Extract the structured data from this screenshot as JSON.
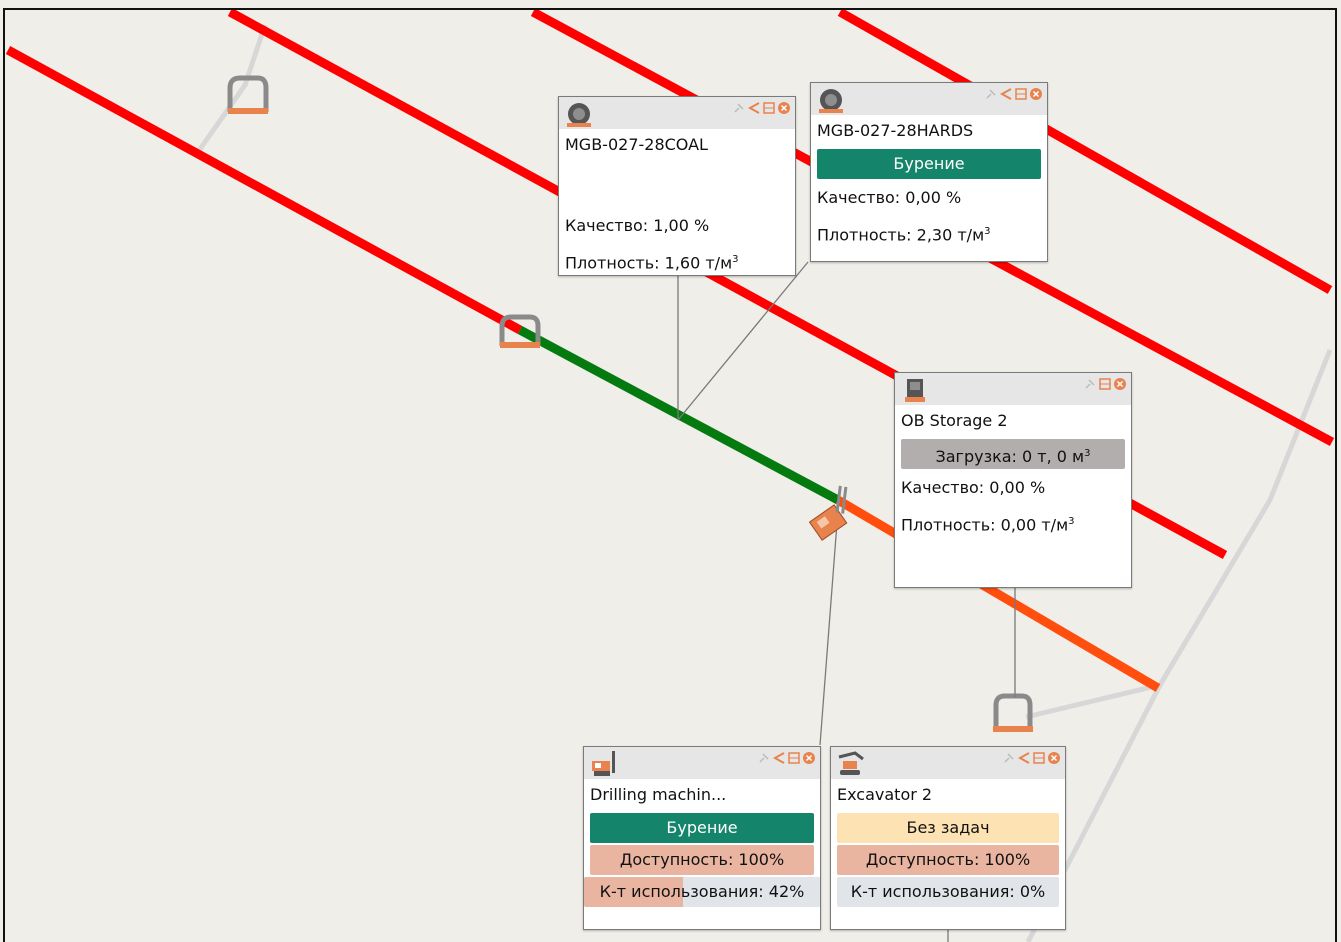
{
  "colors": {
    "map_bg": "#f0eee9",
    "road_red": "#ff0000",
    "road_green": "#047a0f",
    "road_orange": "#ff4e0e",
    "road_grey": "#d7d7d7",
    "status_drilling": "#14856b",
    "status_idle": "#fde3b3",
    "load_grey": "#b2aeae",
    "availability": "#e9b4a0",
    "utilization_track": "#e1e5ea",
    "utilization_fill": "#e9b4a0",
    "icon_orange": "#e8834e"
  },
  "cards": {
    "coal": {
      "icon": "sphere-icon",
      "title": "MGB-027-28COAL",
      "quality": "Качество: 1,00 %",
      "density_prefix": "Плотность: 1,60 т/м",
      "density_sup": "3"
    },
    "hards": {
      "icon": "sphere-icon",
      "title": "MGB-027-28HARDS",
      "status": "Бурение",
      "quality": "Качество: 0,00 %",
      "density_prefix": "Плотность: 2,30 т/м",
      "density_sup": "3"
    },
    "storage": {
      "icon": "storage-bin-icon",
      "title": "OB Storage 2",
      "load": "Загрузка: 0 т, 0 м",
      "load_sup": "3",
      "quality": "Качество: 0,00 %",
      "density_prefix": "Плотность: 0,00 т/м",
      "density_sup": "3"
    },
    "drill": {
      "icon": "drilling-rig-icon",
      "title": "Drilling machin...",
      "status": "Бурение",
      "availability": "Доступность: 100%",
      "availability_value": 1.0,
      "utilization": "К-т использования: 42%",
      "utilization_value": 0.42
    },
    "excavator": {
      "icon": "excavator-icon",
      "title": "Excavator 2",
      "status": "Без задач",
      "availability": "Доступность: 100%",
      "availability_value": 1.0,
      "utilization": "К-т использования: 0%",
      "utilization_value": 0.0
    }
  }
}
